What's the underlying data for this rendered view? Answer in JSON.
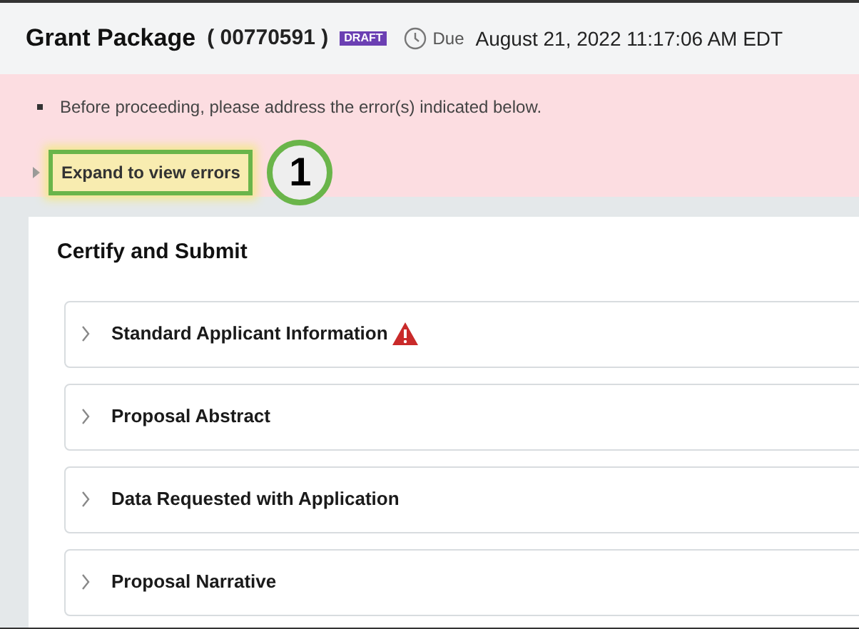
{
  "header": {
    "title": "Grant Package",
    "number": "( 00770591 )",
    "badge": "DRAFT",
    "due_label": "Due",
    "due_date": "August 21, 2022 11:17:06 AM EDT"
  },
  "error_banner": {
    "message": "Before proceeding, please address the error(s) indicated below.",
    "toggle": "Expand to view errors",
    "expanded": false,
    "callout": "1"
  },
  "panel": {
    "title": "Certify and Submit",
    "sections": [
      {
        "label": "Standard Applicant Information",
        "error": true,
        "expanded": false
      },
      {
        "label": "Proposal Abstract",
        "error": false,
        "expanded": false
      },
      {
        "label": "Data Requested with Application",
        "error": false,
        "expanded": false
      },
      {
        "label": "Proposal Narrative",
        "error": false,
        "expanded": false
      }
    ]
  }
}
